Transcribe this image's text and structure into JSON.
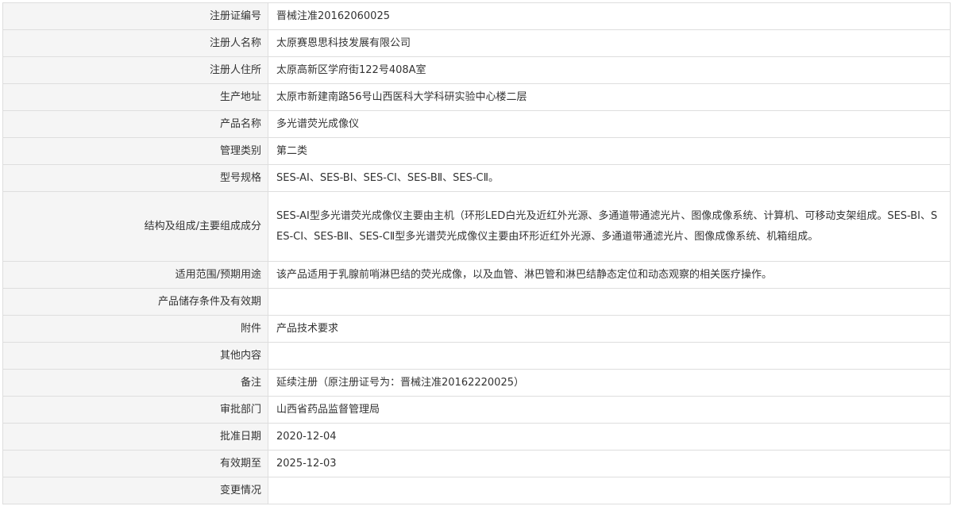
{
  "table": {
    "rows": [
      {
        "label": "注册证编号",
        "value": "晋械注准20162060025"
      },
      {
        "label": "注册人名称",
        "value": "太原赛恩思科技发展有限公司"
      },
      {
        "label": "注册人住所",
        "value": "太原高新区学府街122号408A室"
      },
      {
        "label": "生产地址",
        "value": "太原市新建南路56号山西医科大学科研实验中心楼二层"
      },
      {
        "label": "产品名称",
        "value": "多光谱荧光成像仪"
      },
      {
        "label": "管理类别",
        "value": "第二类"
      },
      {
        "label": "型号规格",
        "value": "SES-AⅠ、SES-BⅠ、SES-CⅠ、SES-BⅡ、SES-CⅡ。"
      },
      {
        "label": "结构及组成/主要组成成分",
        "value": "SES-AⅠ型多光谱荧光成像仪主要由主机（环形LED白光及近红外光源、多通道带通滤光片、图像成像系统、计算机、可移动支架组成。SES-BⅠ、SES-CⅠ、SES-BⅡ、SES-CⅡ型多光谱荧光成像仪主要由环形近红外光源、多通道带通滤光片、图像成像系统、机箱组成。"
      },
      {
        "label": "适用范围/预期用途",
        "value": "该产品适用于乳腺前哨淋巴结的荧光成像，以及血管、淋巴管和淋巴结静态定位和动态观察的相关医疗操作。"
      },
      {
        "label": "产品储存条件及有效期",
        "value": ""
      },
      {
        "label": "附件",
        "value": "产品技术要求"
      },
      {
        "label": "其他内容",
        "value": ""
      },
      {
        "label": "备注",
        "value": "延续注册（原注册证号为：晋械注准20162220025）"
      },
      {
        "label": "审批部门",
        "value": "山西省药品监督管理局"
      },
      {
        "label": "批准日期",
        "value": "2020-12-04"
      },
      {
        "label": "有效期至",
        "value": "2025-12-03"
      },
      {
        "label": "变更情况",
        "value": ""
      }
    ]
  }
}
